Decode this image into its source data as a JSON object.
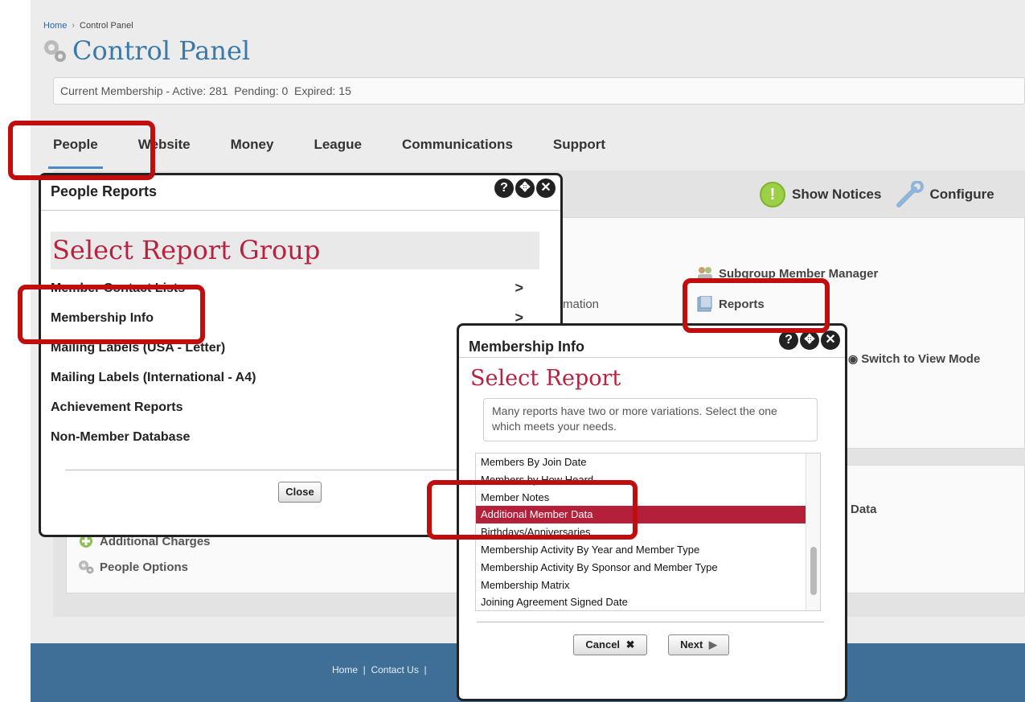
{
  "breadcrumb": {
    "home": "Home",
    "current": "Control Panel"
  },
  "page": {
    "title": "Control Panel"
  },
  "membership_bar": {
    "text": "Current Membership - Active: 281  Pending: 0  Expired: 15"
  },
  "tabs": [
    {
      "label": "People"
    },
    {
      "label": "Website"
    },
    {
      "label": "Money"
    },
    {
      "label": "League"
    },
    {
      "label": "Communications"
    },
    {
      "label": "Support"
    }
  ],
  "toolbar": {
    "show_notices": "Show Notices",
    "configure": "Configure"
  },
  "background_items": {
    "subgroup_manager": "Subgroup Member Manager",
    "reports": "Reports",
    "mation": "mation",
    "switch_view": "Switch to View Mode",
    "data": "Data",
    "additional_charges": "Additional Charges",
    "people_options": "People Options"
  },
  "people_reports_dialog": {
    "title": "People Reports",
    "heading": "Select Report Group",
    "groups": [
      "Member Contact Lists",
      "Membership Info",
      "Mailing Labels (USA - Letter)",
      "Mailing Labels (International - A4)",
      "Achievement Reports",
      "Non-Member Database"
    ],
    "chevron": ">",
    "close_label": "Close"
  },
  "membership_info_dialog": {
    "title": "Membership Info",
    "heading": "Select Report",
    "hint": "Many reports have two or more variations. Select the one which meets your needs.",
    "reports": [
      "Members By Join Date",
      "Members by How Heard",
      "Member Notes",
      "Additional Member Data",
      "Birthdays/Anniversaries",
      "Membership Activity By Year and Member Type",
      "Membership Activity By Sponsor and Member Type",
      "Membership Matrix",
      "Joining Agreement Signed Date"
    ],
    "selected_report": "Additional Member Data",
    "cancel_label": "Cancel",
    "next_label": "Next"
  },
  "footer": {
    "links": "Home  |  Contact Us  |"
  },
  "icons": {
    "help": "question-icon",
    "move": "move-icon",
    "close": "close-icon",
    "cancel": "x-icon",
    "next": "play-arrow-icon"
  },
  "colors": {
    "accent_red": "#b8223f",
    "highlight": "#c00d0d",
    "tab_underline": "#4a89c6",
    "footer": "#3f6f97",
    "title_blue": "#3a7aa8"
  }
}
